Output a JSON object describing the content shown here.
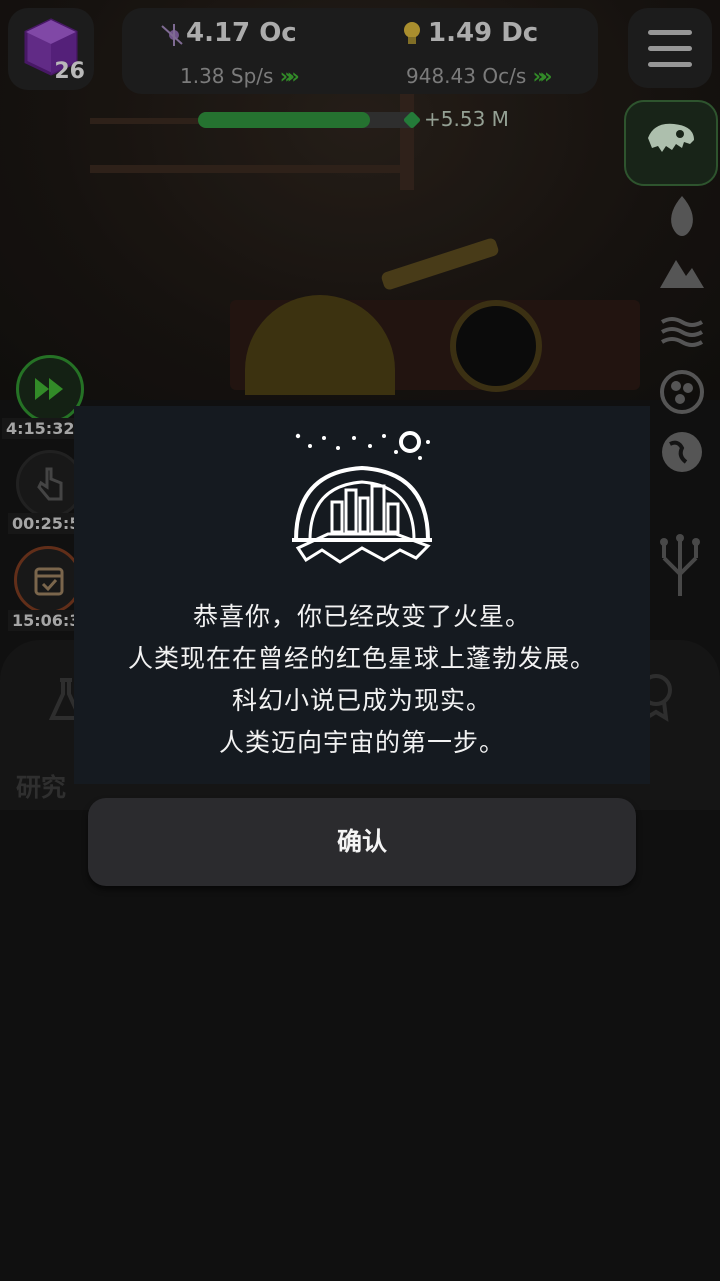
{
  "level": {
    "value": "26",
    "icon": "purple-cube-icon"
  },
  "resources": {
    "primary": {
      "value": "4.17 Oc",
      "rate": "1.38 Sp/s",
      "icon": "satellite-icon"
    },
    "secondary": {
      "value": "1.49 Dc",
      "rate": "948.43 Oc/s",
      "icon": "lightbulb-icon"
    }
  },
  "progress": {
    "label": "+5.53 M",
    "fill_fraction": 0.78
  },
  "timers": [
    {
      "value": "4:15:32:",
      "icon": "fast-forward-icon"
    },
    {
      "value": "00:25:5",
      "icon": "tap-icon"
    },
    {
      "value": "15:06:3",
      "icon": "calendar-check-icon"
    }
  ],
  "side_icons": [
    "fire-icon",
    "mountain-icon",
    "water-icon",
    "cells-icon",
    "globe-icon",
    "tree-icon"
  ],
  "bottom": {
    "research_label": "研究"
  },
  "modal": {
    "lines": [
      "恭喜你，你已经改变了火星。",
      "人类现在在曾经的红色星球上蓬勃发展。",
      "科幻小说已成为现实。",
      "人类迈向宇宙的第一步。"
    ],
    "confirm_label": "确认"
  },
  "colors": {
    "accent_green": "#3fae32",
    "modal_bg": "#151a20",
    "button_bg": "#2b2b2e"
  }
}
